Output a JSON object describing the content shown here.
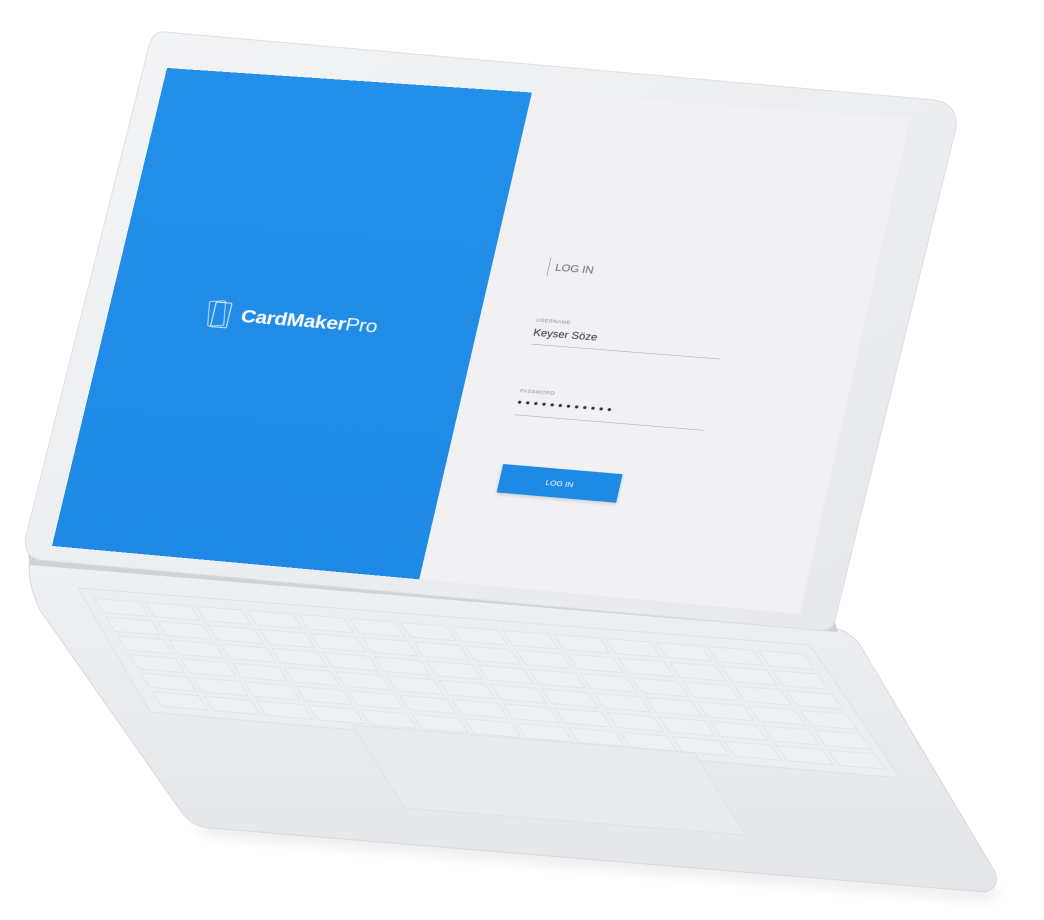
{
  "brand": {
    "name_bold": "CardMaker",
    "name_light": "Pro",
    "logo_icon": "cards-icon"
  },
  "login": {
    "heading": "LOG IN",
    "username_label": "USERNAME",
    "username_value": "Keyser Söze",
    "password_label": "PASSWORD",
    "password_value": "••••••••••••",
    "button_label": "LOG IN"
  },
  "colors": {
    "brand_blue": "#1f8ae6",
    "panel_bg": "#f1f1f3",
    "laptop_body": "#eef0f2"
  }
}
